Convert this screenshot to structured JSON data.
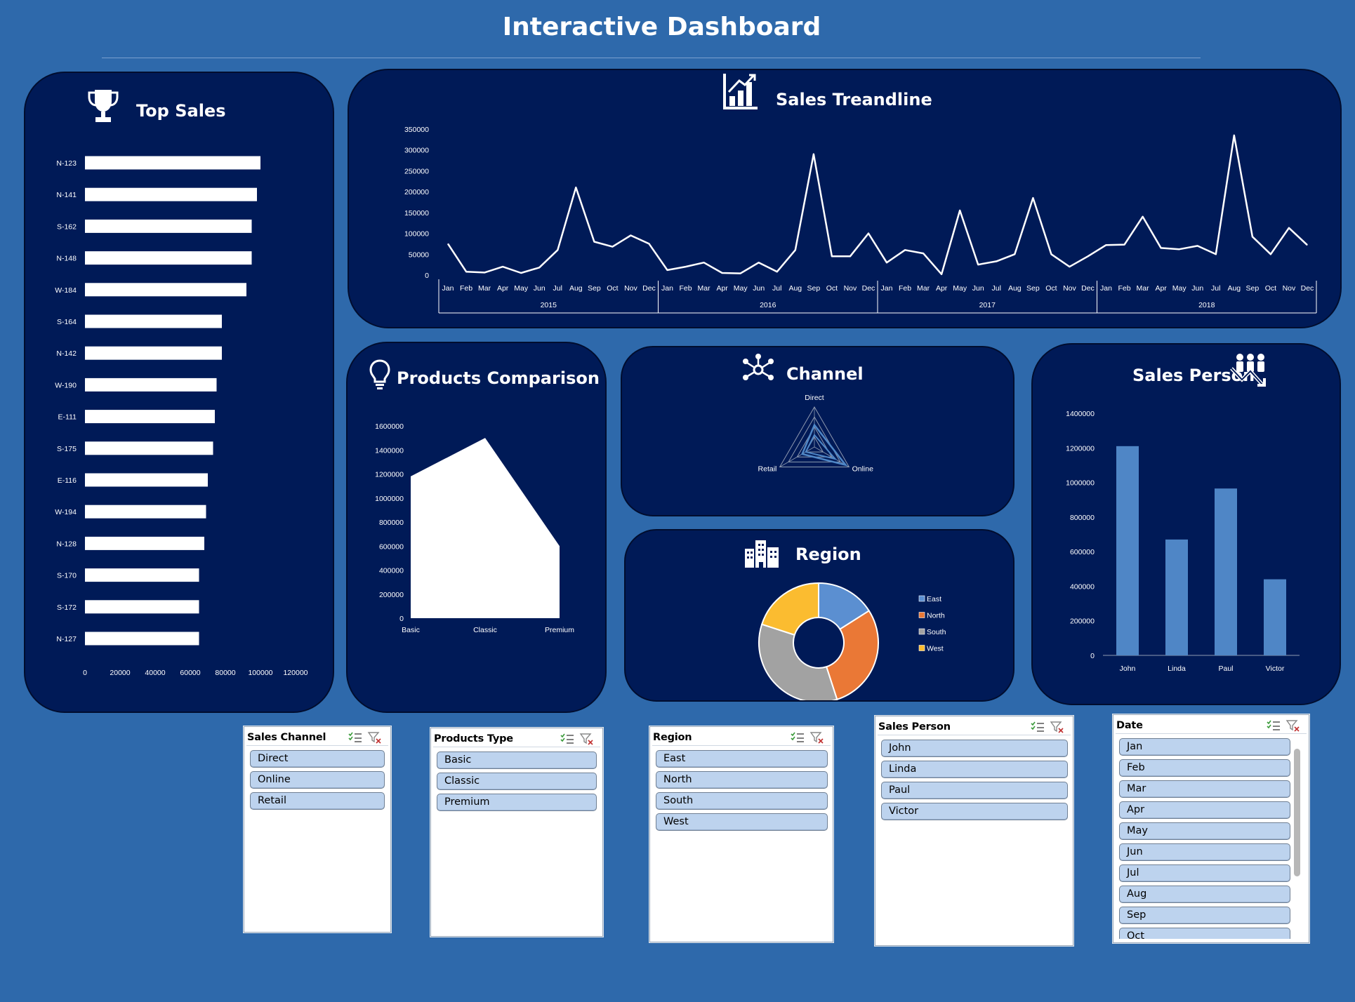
{
  "page": {
    "title": "Interactive Dashboard"
  },
  "top_sales": {
    "title": "Top Sales",
    "chart_data": {
      "type": "bar",
      "orientation": "horizontal",
      "categories": [
        "N-123",
        "N-141",
        "S-162",
        "N-148",
        "W-184",
        "S-164",
        "N-142",
        "W-190",
        "E-111",
        "S-175",
        "E-116",
        "W-194",
        "N-128",
        "S-170",
        "S-172",
        "N-127"
      ],
      "values": [
        100000,
        98000,
        95000,
        95000,
        92000,
        78000,
        78000,
        75000,
        74000,
        73000,
        70000,
        69000,
        68000,
        65000,
        65000,
        65000
      ],
      "xlim": [
        0,
        120000
      ],
      "xticks": [
        "0",
        "20000",
        "40000",
        "60000",
        "80000",
        "100000",
        "120000"
      ],
      "grid": false
    }
  },
  "sales_trendline": {
    "title": "Sales Treandline",
    "chart_data": {
      "type": "line",
      "months": [
        "Jan",
        "Feb",
        "Mar",
        "Apr",
        "May",
        "Jun",
        "Jul",
        "Aug",
        "Sep",
        "Oct",
        "Nov",
        "Dec"
      ],
      "years": [
        "2015",
        "2016",
        "2017",
        "2018"
      ],
      "values": [
        75000,
        8000,
        6000,
        20000,
        5000,
        18000,
        60000,
        210000,
        80000,
        68000,
        95000,
        75000,
        12000,
        20000,
        30000,
        5000,
        4000,
        30000,
        8000,
        60000,
        290000,
        45000,
        45000,
        100000,
        30000,
        60000,
        52000,
        2000,
        155000,
        25000,
        33000,
        50000,
        185000,
        50000,
        20000,
        45000,
        72000,
        73000,
        140000,
        65000,
        62000,
        70000,
        50000,
        335000,
        92000,
        50000,
        113000,
        72000
      ],
      "ylim": [
        0,
        350000
      ],
      "yticks": [
        "0",
        "50000",
        "100000",
        "150000",
        "200000",
        "250000",
        "300000",
        "350000"
      ],
      "grid": false
    }
  },
  "products_comparison": {
    "title": "Products Comparison",
    "chart_data": {
      "type": "area",
      "categories": [
        "Basic",
        "Classic",
        "Premium"
      ],
      "values": [
        1180000,
        1500000,
        600000
      ],
      "ylim": [
        0,
        1600000
      ],
      "yticks": [
        "0",
        "200000",
        "400000",
        "600000",
        "800000",
        "1000000",
        "1200000",
        "1400000",
        "1600000"
      ]
    }
  },
  "channel": {
    "title": "Channel",
    "chart_data": {
      "type": "radar",
      "categories": [
        "Direct",
        "Online",
        "Retail"
      ],
      "rings": 4
    }
  },
  "region": {
    "title": "Region",
    "chart_data": {
      "type": "pie",
      "variant": "doughnut",
      "categories": [
        "East",
        "North",
        "South",
        "West"
      ],
      "values": [
        16,
        29,
        35,
        20
      ],
      "colors": [
        "#5b8fd1",
        "#ea7836",
        "#a2a2a2",
        "#fbbc30"
      ],
      "legend": "right"
    }
  },
  "sales_person": {
    "title": "Sales Person",
    "chart_data": {
      "type": "bar",
      "categories": [
        "John",
        "Linda",
        "Paul",
        "Victor"
      ],
      "values": [
        1210000,
        670000,
        965000,
        440000
      ],
      "ylim": [
        0,
        1400000
      ],
      "yticks": [
        "0",
        "200000",
        "400000",
        "600000",
        "800000",
        "1000000",
        "1200000",
        "1400000"
      ],
      "color": "#4f86c6"
    }
  },
  "slicers": {
    "sales_channel": {
      "title": "Sales Channel",
      "items": [
        "Direct",
        "Online",
        "Retail"
      ]
    },
    "products_type": {
      "title": "Products Type",
      "items": [
        "Basic",
        "Classic",
        "Premium"
      ]
    },
    "region": {
      "title": "Region",
      "items": [
        "East",
        "North",
        "South",
        "West"
      ]
    },
    "sales_person": {
      "title": "Sales Person",
      "items": [
        "John",
        "Linda",
        "Paul",
        "Victor"
      ]
    },
    "date": {
      "title": "Date",
      "items": [
        "Jan",
        "Feb",
        "Mar",
        "Apr",
        "May",
        "Jun",
        "Jul",
        "Aug",
        "Sep",
        "Oct"
      ]
    }
  },
  "colors": {
    "background": "#2e69ab",
    "panel": "#001a57",
    "slicer_item": "#bdd3ee"
  },
  "icons": {
    "top_sales": "trophy-icon",
    "sales_trendline": "bar-chart-trend-icon",
    "products_comparison": "lightbulb-icon",
    "channel": "network-hub-icon",
    "region": "buildings-icon",
    "sales_person": "people-growth-icon",
    "slicer_multiselect": "multi-select-icon",
    "slicer_clear": "clear-filter-icon"
  }
}
